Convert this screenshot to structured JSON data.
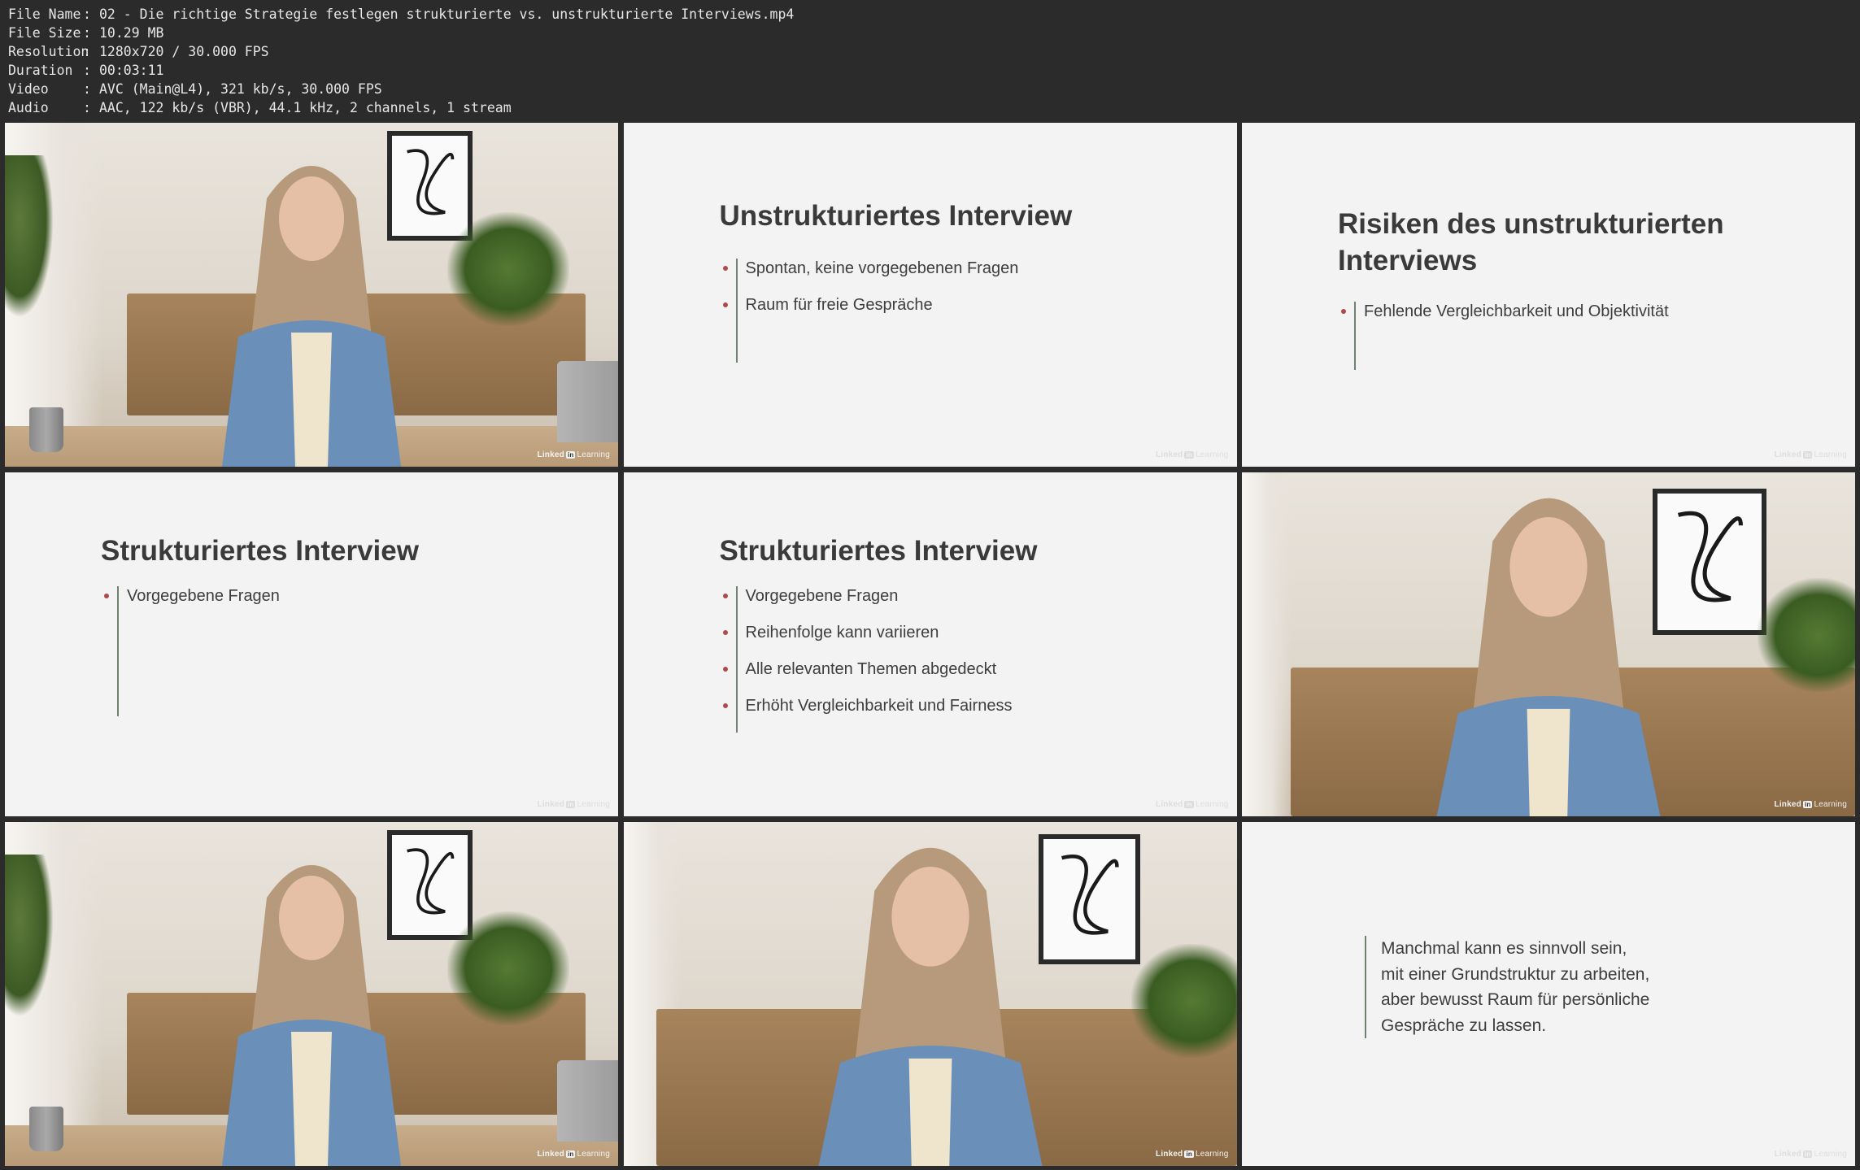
{
  "meta": {
    "rows": [
      {
        "key": "File Name",
        "value": "02 - Die richtige Strategie festlegen strukturierte vs. unstrukturierte Interviews.mp4"
      },
      {
        "key": "File Size",
        "value": "10.29 MB"
      },
      {
        "key": "Resolution",
        "value": "1280x720 / 30.000 FPS"
      },
      {
        "key": "Duration",
        "value": "00:03:11"
      },
      {
        "key": "Video",
        "value": "AVC (Main@L4), 321 kb/s, 30.000 FPS"
      },
      {
        "key": "Audio",
        "value": "AAC, 122 kb/s (VBR), 44.1 kHz, 2 channels, 1 stream"
      }
    ]
  },
  "logo": {
    "linked": "Linked",
    "in": "in",
    "learning": "Learning"
  },
  "frames": {
    "f2": {
      "title": "Unstrukturiertes Interview",
      "bullets": [
        "Spontan, keine vorgegebenen Fragen",
        "Raum für freie Gespräche"
      ]
    },
    "f3": {
      "title_line1": "Risiken des unstrukturierten",
      "title_line2": "Interviews",
      "bullets": [
        "Fehlende Vergleichbarkeit und Objektivität"
      ]
    },
    "f4": {
      "title": "Strukturiertes Interview",
      "bullets": [
        "Vorgegebene Fragen"
      ]
    },
    "f5": {
      "title": "Strukturiertes Interview",
      "bullets": [
        "Vorgegebene Fragen",
        "Reihenfolge kann variieren",
        "Alle relevanten Themen abgedeckt",
        "Erhöht Vergleichbarkeit und Fairness"
      ]
    },
    "f9": {
      "lines": [
        "Manchmal kann es sinnvoll sein,",
        "mit einer Grundstruktur zu arbeiten,",
        "aber bewusst Raum für persönliche",
        "Gespräche zu lassen."
      ]
    }
  }
}
